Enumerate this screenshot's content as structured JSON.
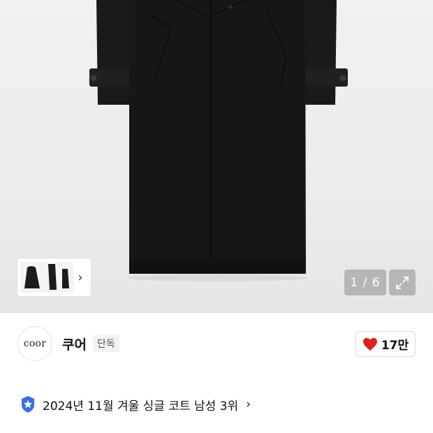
{
  "product_gallery": {
    "image_alt": "black long coat",
    "pager": "1 / 6",
    "thumbnail_arrow": "›",
    "icons": {
      "expand": "expand-arrows-icon",
      "thumb_next": "chevron-right-icon"
    }
  },
  "brand": {
    "logo_text": "coor",
    "name": "쿠어",
    "badge": "단독"
  },
  "like": {
    "count": "17만",
    "icon": "heart-icon",
    "color": "#e0201d"
  },
  "ranking": {
    "text": "2024년 11월 겨울 싱글 코트 남성 3위",
    "chevron": "›",
    "icon": "star-badge-icon",
    "icon_color": "#3a6ee8"
  }
}
